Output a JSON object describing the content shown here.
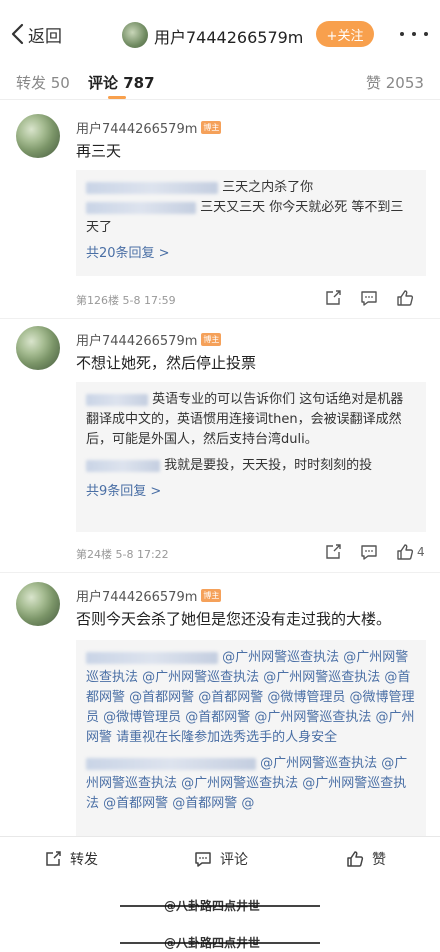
{
  "nav": {
    "back_label": "返回",
    "username": "用户7444266579m",
    "follow_label": "+关注"
  },
  "tabs": {
    "repost": "转发 50",
    "comments": "评论 787",
    "likes": "赞 2053"
  },
  "comments": [
    {
      "user": "用户7444266579m",
      "badge": "博主",
      "text": "再三天",
      "replies": [
        {
          "text": "三天之内杀了你"
        },
        {
          "text": "三天又三天 你今天就必死 等不到三天了"
        }
      ],
      "more": "共20条回复 >",
      "meta": "第126楼 5-8 17:59",
      "likes": ""
    },
    {
      "user": "用户7444266579m",
      "badge": "博主",
      "text": "不想让她死，然后停止投票",
      "replies": [
        {
          "text": "英语专业的可以告诉你们 这句话绝对是机器翻译成中文的，英语惯用连接词then，会被误翻译成然后，可能是外国人，然后支持台湾duli。"
        },
        {
          "text": "我就是要投，天天投，时时刻刻的投"
        }
      ],
      "more": "共9条回复 >",
      "meta": "第24楼 5-8 17:22",
      "likes": "4"
    },
    {
      "user": "用户7444266579m",
      "badge": "博主",
      "text": "否则今天会杀了她但是您还没有走过我的大楼。",
      "replies": [
        {
          "text": "@广州网警巡查执法 @广州网警巡查执法 @广州网警巡查执法 @广州网警巡查执法 @首都网警 @首都网警 @首都网警 @微博管理员 @微博管理员 @微博管理员 @首都网警 @广州网警巡查执法 @广州网警 请重视在长隆参加选秀选手的人身安全"
        },
        {
          "text": "@广州网警巡查执法 @广州网警巡查执法 @广州网警巡查执法 @广州网警巡查执法 @首都网警 @首都网警 @"
        }
      ]
    }
  ],
  "bottom": {
    "repost": "转发",
    "comment": "评论",
    "like": "赞"
  },
  "watermarks": [
    "@八卦路四点井世",
    "@八卦路四点井世"
  ],
  "colors": {
    "accent": "#f8a04d",
    "link": "#4a6fa5"
  }
}
